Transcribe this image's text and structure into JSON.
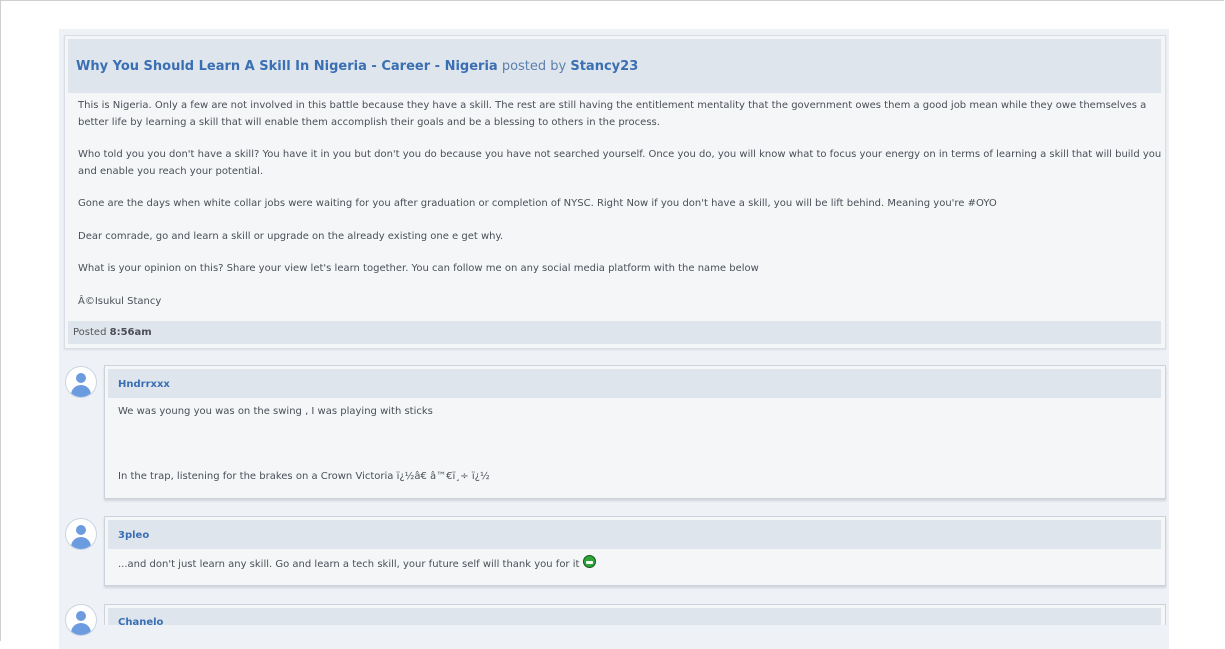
{
  "post": {
    "title": "Why You Should Learn A Skill In Nigeria",
    "sep1": " - ",
    "section": "Career",
    "sep2": " - ",
    "board": "Nigeria",
    "posted_by_label": " posted by ",
    "author": "Stancy23",
    "paragraphs": [
      "This is Nigeria. Only a few are not involved in this battle because they have a skill. The rest are still having the entitlement mentality that the government owes them a good job mean while they owe themselves a better life by learning a skill that will enable them accomplish their goals and be a blessing to others in the process.",
      "Who told you you don't have a skill? You have it in you but don't you do because you have not searched yourself. Once you do, you will know what to focus your energy on in terms of learning a skill that will build you and enable you reach your potential.",
      "Gone are the days when white collar jobs were waiting for you after graduation or completion of  NYSC. Right Now if you don't have a skill, you will be lift behind. Meaning you're #OYO",
      "Dear comrade, go and learn a skill or upgrade on the already existing one e get why.",
      "What is your opinion on this? Share your view let's learn together. You can follow me on any social media platform with the name below",
      "Â©Isukul Stancy"
    ],
    "footer_label": "Posted ",
    "footer_time": "8:56am"
  },
  "replies": [
    {
      "username": "Hndrrxxx",
      "line1": "We was young you was on the swing , I was playing with sticks",
      "line2": "In the trap, listening for the brakes on a Crown Victoria ï¿½â€  â™€ï¸÷ ï¿½"
    },
    {
      "username": "3pleo",
      "line1": "...and don't just learn any skill. Go and learn a tech skill, your future self will thank you for it",
      "emoji": "grin-emoji"
    },
    {
      "username": "Chanelo"
    }
  ],
  "colors": {
    "link": "#3a6fb3",
    "header_bg": "#dfe5ed",
    "panel_bg": "#f4f6f8"
  }
}
